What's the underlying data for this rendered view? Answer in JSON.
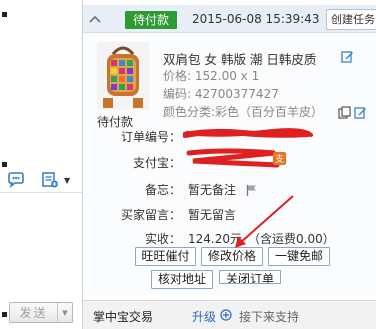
{
  "order": {
    "status": "待付款",
    "time": "2015-06-08 15:39:43",
    "create_task": "创建任务"
  },
  "product": {
    "status": "待付款",
    "title": "双肩包 女 韩版 潮 日韩皮质",
    "price": "价格: 152.00 x 1",
    "code": "编码: 42700377427",
    "sku": "颜色分类:彩色（百分百羊皮）"
  },
  "details": {
    "order_no_label": "订单编号：",
    "alipay_label": "支付宝：",
    "remark_label": "备忘：",
    "remark_value": "暂无备注",
    "buyer_msg_label": "买家留言：",
    "buyer_msg_value": "暂无留言",
    "paid_label": "实收：",
    "paid_value": "124.20元",
    "shipping": "（含运费0.00）"
  },
  "actions": {
    "remind": "旺旺催付",
    "modify_price": "修改价格",
    "waive": "一键免邮",
    "verify_address": "核对地址",
    "close_trade": "关闭订单"
  },
  "bottom": {
    "title": "掌中宝交易",
    "upgrade": "升级",
    "text": "接下来支持"
  },
  "left": {
    "send": "发送"
  },
  "colors": {
    "status_green": "#2d9b34",
    "link_blue": "#2b6ac2",
    "button_border": "#8ca7c5",
    "annotation_red": "#e02020"
  },
  "icons": [
    "collapse-icon",
    "edit-icon",
    "copy-icon",
    "alipay-icon",
    "flag-icon",
    "chat-icon",
    "add-note-icon",
    "upgrade-icon"
  ]
}
